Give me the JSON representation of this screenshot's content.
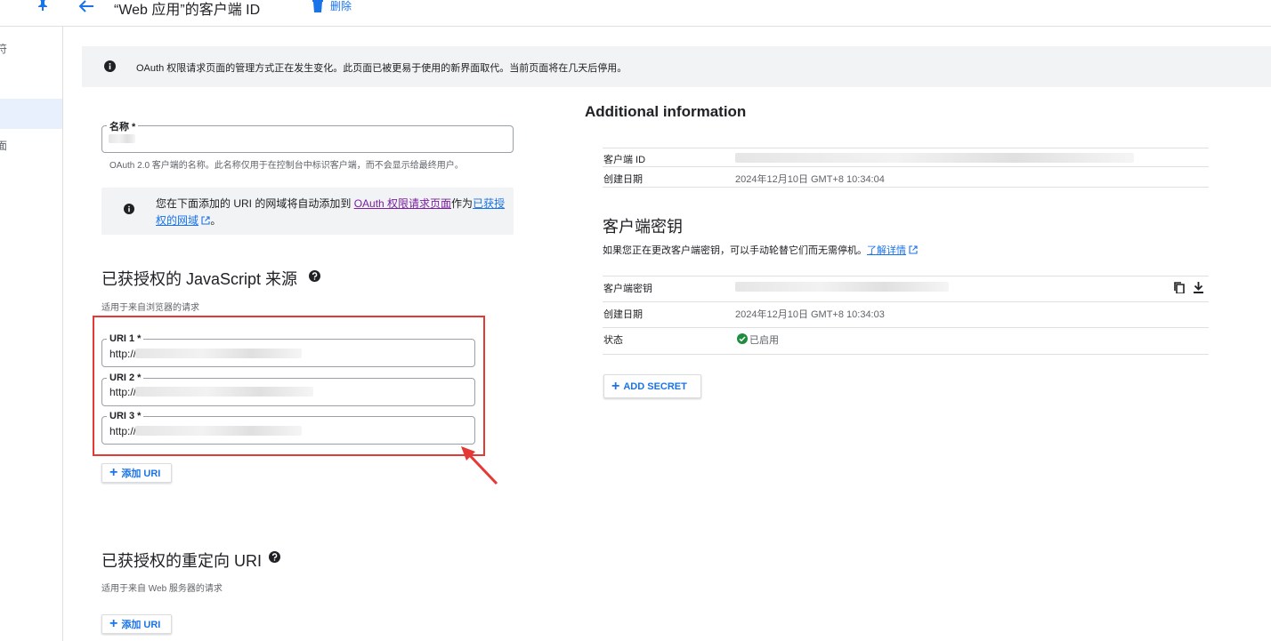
{
  "header": {
    "title": "“Web 应用”的客户端 ID",
    "delete_label": "删除"
  },
  "leftnav": {
    "fragments": [
      "符",
      "面"
    ]
  },
  "banner": {
    "text": "OAuth 权限请求页面的管理方式正在发生变化。此页面已被更易于使用的新界面取代。当前页面将在几天后停用。"
  },
  "form": {
    "name_label": "名称 *",
    "name_help": "OAuth 2.0 客户端的名称。此名称仅用于在控制台中标识客户端，而不会显示给最终用户。",
    "note_prefix": "您在下面添加的 URI 的网域将自动添加到",
    "note_link1": "OAuth 权限请求页面",
    "note_middle": "作为",
    "note_link2a": "已获授",
    "note_link2b": "权的网域",
    "note_end": "。",
    "js_title": "已获授权的 JavaScript 来源",
    "js_sub": "适用于来自浏览器的请求",
    "uris": [
      {
        "label": "URI 1 *",
        "value": "http://"
      },
      {
        "label": "URI 2 *",
        "value": "http://"
      },
      {
        "label": "URI 3 *",
        "value": "http://"
      }
    ],
    "add_uri": "添加 URI",
    "redirect_title": "已获授权的重定向 URI",
    "redirect_sub": "适用于来自 Web 服务器的请求",
    "add_uri2": "添加 URI"
  },
  "info": {
    "title": "Additional information",
    "client_id_label": "客户端 ID",
    "created_label": "创建日期",
    "created_value": "2024年12月10日 GMT+8 10:34:04"
  },
  "secrets": {
    "title": "客户端密钥",
    "desc": "如果您正在更改客户端密钥，可以手动轮替它们而无需停机。",
    "learn_more": "了解详情",
    "secret_label": "客户端密钥",
    "created_label": "创建日期",
    "created_value": "2024年12月10日 GMT+8 10:34:03",
    "status_label": "状态",
    "status_value": "已启用",
    "add_secret": "ADD SECRET"
  },
  "colors": {
    "accent": "#1a73e8",
    "annotation_red": "#e53935",
    "enabled_green": "#1e8e3e"
  }
}
